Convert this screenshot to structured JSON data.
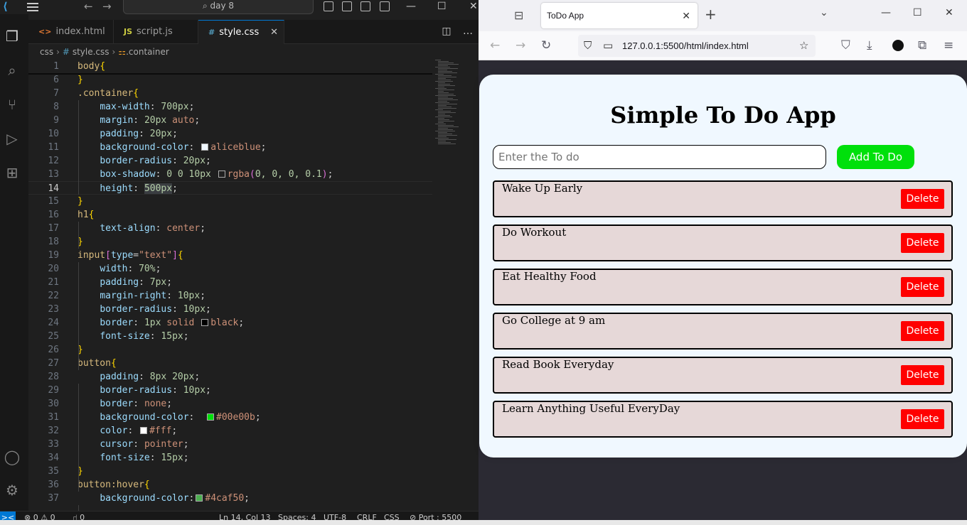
{
  "vscode": {
    "search_text": "day 8",
    "tabs": [
      {
        "icon": "<>",
        "label": "index.html"
      },
      {
        "icon": "JS",
        "label": "script.js"
      },
      {
        "icon": "#",
        "label": "style.css"
      }
    ],
    "breadcrumb": {
      "folder": "css",
      "file": "style.css",
      "symbol": ".container"
    },
    "status": {
      "remote": "><",
      "problems": "⊗ 0 ⚠ 0",
      "ports": "⑁ 0",
      "position": "Ln 14, Col 13",
      "spaces": "Spaces: 4",
      "encoding": "UTF-8",
      "eol": "CRLF",
      "language": "CSS",
      "liveserver": "⊘ Port : 5500"
    }
  },
  "code_lines": [
    {
      "n": "1",
      "segs": [
        [
          "t-sel",
          "body"
        ],
        [
          "t-brace2",
          "{"
        ]
      ]
    },
    {
      "n": "6",
      "segs": [
        [
          "t-brace2",
          "}"
        ]
      ]
    },
    {
      "n": "7",
      "segs": [
        [
          "t-sel",
          ".container"
        ],
        [
          "t-brace2",
          "{"
        ]
      ]
    },
    {
      "n": "8",
      "segs": [
        [
          "t-punc",
          "    "
        ],
        [
          "t-prop",
          "max-width"
        ],
        [
          "t-punc",
          ": "
        ],
        [
          "t-num",
          "700px"
        ],
        [
          "t-punc",
          ";"
        ]
      ]
    },
    {
      "n": "9",
      "segs": [
        [
          "t-punc",
          "    "
        ],
        [
          "t-prop",
          "margin"
        ],
        [
          "t-punc",
          ": "
        ],
        [
          "t-num",
          "20px"
        ],
        [
          "t-punc",
          " "
        ],
        [
          "t-val",
          "auto"
        ],
        [
          "t-punc",
          ";"
        ]
      ]
    },
    {
      "n": "10",
      "segs": [
        [
          "t-punc",
          "    "
        ],
        [
          "t-prop",
          "padding"
        ],
        [
          "t-punc",
          ": "
        ],
        [
          "t-num",
          "20px"
        ],
        [
          "t-punc",
          ";"
        ]
      ]
    },
    {
      "n": "11",
      "segs": [
        [
          "t-punc",
          "    "
        ],
        [
          "t-prop",
          "background-color"
        ],
        [
          "t-punc",
          ": "
        ],
        [
          "swatch",
          "#f0f8ff"
        ],
        [
          "t-val",
          "aliceblue"
        ],
        [
          "t-punc",
          ";"
        ]
      ]
    },
    {
      "n": "12",
      "segs": [
        [
          "t-punc",
          "    "
        ],
        [
          "t-prop",
          "border-radius"
        ],
        [
          "t-punc",
          ": "
        ],
        [
          "t-num",
          "20px"
        ],
        [
          "t-punc",
          ";"
        ]
      ]
    },
    {
      "n": "13",
      "segs": [
        [
          "t-punc",
          "    "
        ],
        [
          "t-prop",
          "box-shadow"
        ],
        [
          "t-punc",
          ": "
        ],
        [
          "t-num",
          "0 0 10px"
        ],
        [
          "t-punc",
          " "
        ],
        [
          "swatch",
          "#1f1f1f"
        ],
        [
          "t-val",
          "rgba"
        ],
        [
          "t-brace",
          "("
        ],
        [
          "t-num",
          "0, 0, 0, 0.1"
        ],
        [
          "t-brace",
          ")"
        ],
        [
          "t-punc",
          ";"
        ]
      ]
    },
    {
      "n": "14",
      "segs": [
        [
          "t-punc",
          "    "
        ],
        [
          "t-prop",
          "height"
        ],
        [
          "t-punc",
          ": "
        ],
        [
          "t-num t-hl",
          "500px"
        ],
        [
          "t-punc",
          ";"
        ]
      ]
    },
    {
      "n": "15",
      "segs": [
        [
          "t-brace2",
          "}"
        ]
      ]
    },
    {
      "n": "16",
      "segs": [
        [
          "t-sel",
          "h1"
        ],
        [
          "t-brace2",
          "{"
        ]
      ]
    },
    {
      "n": "17",
      "segs": [
        [
          "t-punc",
          "    "
        ],
        [
          "t-prop",
          "text-align"
        ],
        [
          "t-punc",
          ": "
        ],
        [
          "t-val",
          "center"
        ],
        [
          "t-punc",
          ";"
        ]
      ]
    },
    {
      "n": "18",
      "segs": [
        [
          "t-brace2",
          "}"
        ]
      ]
    },
    {
      "n": "19",
      "segs": [
        [
          "t-sel",
          "input"
        ],
        [
          "t-brace",
          "["
        ],
        [
          "t-prop",
          "type"
        ],
        [
          "t-punc",
          "="
        ],
        [
          "t-str",
          "\"text\""
        ],
        [
          "t-brace",
          "]"
        ],
        [
          "t-brace2",
          "{"
        ]
      ]
    },
    {
      "n": "20",
      "segs": [
        [
          "t-punc",
          "    "
        ],
        [
          "t-prop",
          "width"
        ],
        [
          "t-punc",
          ": "
        ],
        [
          "t-num",
          "70%"
        ],
        [
          "t-punc",
          ";"
        ]
      ]
    },
    {
      "n": "21",
      "segs": [
        [
          "t-punc",
          "    "
        ],
        [
          "t-prop",
          "padding"
        ],
        [
          "t-punc",
          ": "
        ],
        [
          "t-num",
          "7px"
        ],
        [
          "t-punc",
          ";"
        ]
      ]
    },
    {
      "n": "22",
      "segs": [
        [
          "t-punc",
          "    "
        ],
        [
          "t-prop",
          "margin-right"
        ],
        [
          "t-punc",
          ": "
        ],
        [
          "t-num",
          "10px"
        ],
        [
          "t-punc",
          ";"
        ]
      ]
    },
    {
      "n": "23",
      "segs": [
        [
          "t-punc",
          "    "
        ],
        [
          "t-prop",
          "border-radius"
        ],
        [
          "t-punc",
          ": "
        ],
        [
          "t-num",
          "10px"
        ],
        [
          "t-punc",
          ";"
        ]
      ]
    },
    {
      "n": "24",
      "segs": [
        [
          "t-punc",
          "    "
        ],
        [
          "t-prop",
          "border"
        ],
        [
          "t-punc",
          ": "
        ],
        [
          "t-num",
          "1px"
        ],
        [
          "t-punc",
          " "
        ],
        [
          "t-val",
          "solid"
        ],
        [
          "t-punc",
          " "
        ],
        [
          "swatch",
          "#000000"
        ],
        [
          "t-val",
          "black"
        ],
        [
          "t-punc",
          ";"
        ]
      ]
    },
    {
      "n": "25",
      "segs": [
        [
          "t-punc",
          "    "
        ],
        [
          "t-prop",
          "font-size"
        ],
        [
          "t-punc",
          ": "
        ],
        [
          "t-num",
          "15px"
        ],
        [
          "t-punc",
          ";"
        ]
      ]
    },
    {
      "n": "26",
      "segs": [
        [
          "t-brace2",
          "}"
        ]
      ]
    },
    {
      "n": "27",
      "segs": [
        [
          "t-sel",
          "button"
        ],
        [
          "t-brace2",
          "{"
        ]
      ]
    },
    {
      "n": "28",
      "segs": [
        [
          "t-punc",
          "    "
        ],
        [
          "t-prop",
          "padding"
        ],
        [
          "t-punc",
          ": "
        ],
        [
          "t-num",
          "8px 20px"
        ],
        [
          "t-punc",
          ";"
        ]
      ]
    },
    {
      "n": "29",
      "segs": [
        [
          "t-punc",
          "    "
        ],
        [
          "t-prop",
          "border-radius"
        ],
        [
          "t-punc",
          ": "
        ],
        [
          "t-num",
          "10px"
        ],
        [
          "t-punc",
          ";"
        ]
      ]
    },
    {
      "n": "30",
      "segs": [
        [
          "t-punc",
          "    "
        ],
        [
          "t-prop",
          "border"
        ],
        [
          "t-punc",
          ": "
        ],
        [
          "t-val",
          "none"
        ],
        [
          "t-punc",
          ";"
        ]
      ]
    },
    {
      "n": "31",
      "segs": [
        [
          "t-punc",
          "    "
        ],
        [
          "t-prop",
          "background-color"
        ],
        [
          "t-punc",
          ":  "
        ],
        [
          "swatch",
          "#00e00b"
        ],
        [
          "t-val",
          "#00e00b"
        ],
        [
          "t-punc",
          ";"
        ]
      ]
    },
    {
      "n": "32",
      "segs": [
        [
          "t-punc",
          "    "
        ],
        [
          "t-prop",
          "color"
        ],
        [
          "t-punc",
          ": "
        ],
        [
          "swatch",
          "#ffffff"
        ],
        [
          "t-val",
          "#fff"
        ],
        [
          "t-punc",
          ";"
        ]
      ]
    },
    {
      "n": "33",
      "segs": [
        [
          "t-punc",
          "    "
        ],
        [
          "t-prop",
          "cursor"
        ],
        [
          "t-punc",
          ": "
        ],
        [
          "t-val",
          "pointer"
        ],
        [
          "t-punc",
          ";"
        ]
      ]
    },
    {
      "n": "34",
      "segs": [
        [
          "t-punc",
          "    "
        ],
        [
          "t-prop",
          "font-size"
        ],
        [
          "t-punc",
          ": "
        ],
        [
          "t-num",
          "15px"
        ],
        [
          "t-punc",
          ";"
        ]
      ]
    },
    {
      "n": "35",
      "segs": [
        [
          "t-brace2",
          "}"
        ]
      ]
    },
    {
      "n": "36",
      "segs": [
        [
          "t-sel",
          "button:hover"
        ],
        [
          "t-brace2",
          "{"
        ]
      ]
    },
    {
      "n": "37",
      "segs": [
        [
          "t-punc",
          "    "
        ],
        [
          "t-prop",
          "background-color"
        ],
        [
          "t-punc",
          ":"
        ],
        [
          "swatch",
          "#4caf50"
        ],
        [
          "t-val",
          "#4caf50"
        ],
        [
          "t-punc",
          ";"
        ]
      ]
    }
  ],
  "browser": {
    "tab_title": "ToDo App",
    "url": "127.0.0.1:5500/html/index.html"
  },
  "app": {
    "title": "Simple To Do App",
    "input_placeholder": "Enter the To do",
    "add_label": "Add To Do",
    "delete_label": "Delete",
    "todos": [
      "Wake Up Early",
      "Do Workout",
      "Eat Healthy Food",
      "Go College at 9 am",
      "Read Book Everyday",
      "Learn Anything Useful EveryDay"
    ]
  },
  "colors": {
    "container_bg": "#f0f8ff",
    "add_button": "#00e00b",
    "delete_button": "#ff0000",
    "todo_bg": "#e6d8d8",
    "accent": "#0078d4"
  }
}
